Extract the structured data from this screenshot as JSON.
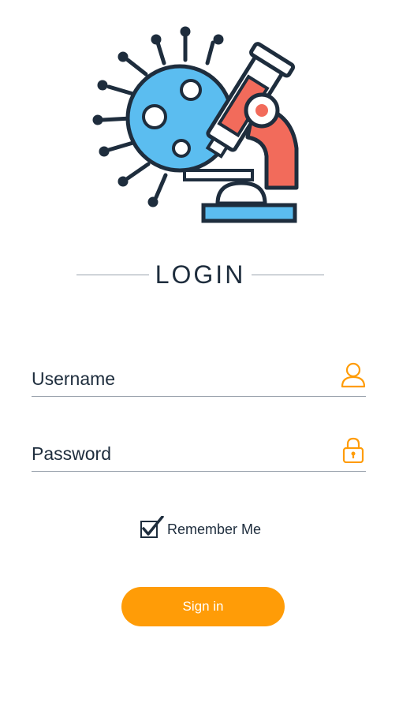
{
  "header": {
    "title": "LOGIN"
  },
  "form": {
    "username": {
      "placeholder": "Username",
      "value": ""
    },
    "password": {
      "placeholder": "Password",
      "value": ""
    },
    "remember": {
      "label": "Remember Me",
      "checked": true
    },
    "submit_label": "Sign in"
  },
  "icons": {
    "logo": "virus-microscope-logo",
    "username": "user-icon",
    "password": "lock-icon",
    "checkbox": "checkmark-icon"
  },
  "colors": {
    "accent": "#ff9c07",
    "text": "#1e2d3d",
    "virus_blue": "#5bbdf0",
    "microscope_red": "#f26b5b",
    "divider": "#9aa3ad"
  }
}
